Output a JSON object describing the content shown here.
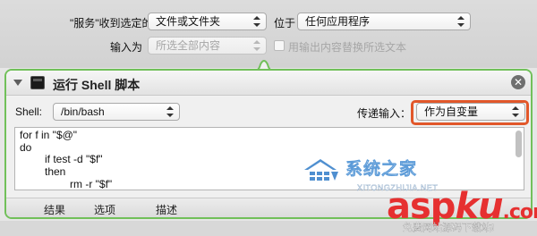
{
  "top_cut_labels": [
    "...",
    "...",
    "..."
  ],
  "service": {
    "receives_label": "\"服务\"收到选定的",
    "receives_value": "文件或文件夹",
    "in_label": "位于",
    "in_value": "任何应用程序",
    "input_is_label": "输入为",
    "input_is_value": "所选全部内容",
    "replace_checkbox_label": "用输出内容替换所选文本"
  },
  "action": {
    "title": "运行 Shell 脚本",
    "shell_label": "Shell:",
    "shell_value": "/bin/bash",
    "pass_input_label": "传递输入：",
    "pass_input_value": "作为自变量",
    "close_glyph": "✕",
    "code_lines": [
      "for f in \"$@\"",
      "do",
      "if test -d \"$f\"",
      "then",
      "rm -r \"$f\""
    ],
    "footer_tabs": [
      "结果",
      "选项",
      "描述"
    ]
  },
  "watermarks": {
    "xitong_title": "系统之家",
    "xitong_url": "XITONGZHIJIA.NET",
    "aspku_a": "asp",
    "aspku_b": "ku",
    "aspku_c": ".com",
    "aspku_sub": "免费网站源码下载站!"
  },
  "colors": {
    "highlight_box": "#e2572a",
    "panel_border": "#71c05a",
    "aspku_red": "#e63030"
  },
  "icons": [
    "terminal-icon",
    "disclosure-triangle-icon",
    "close-icon",
    "popup-arrows-icon"
  ]
}
